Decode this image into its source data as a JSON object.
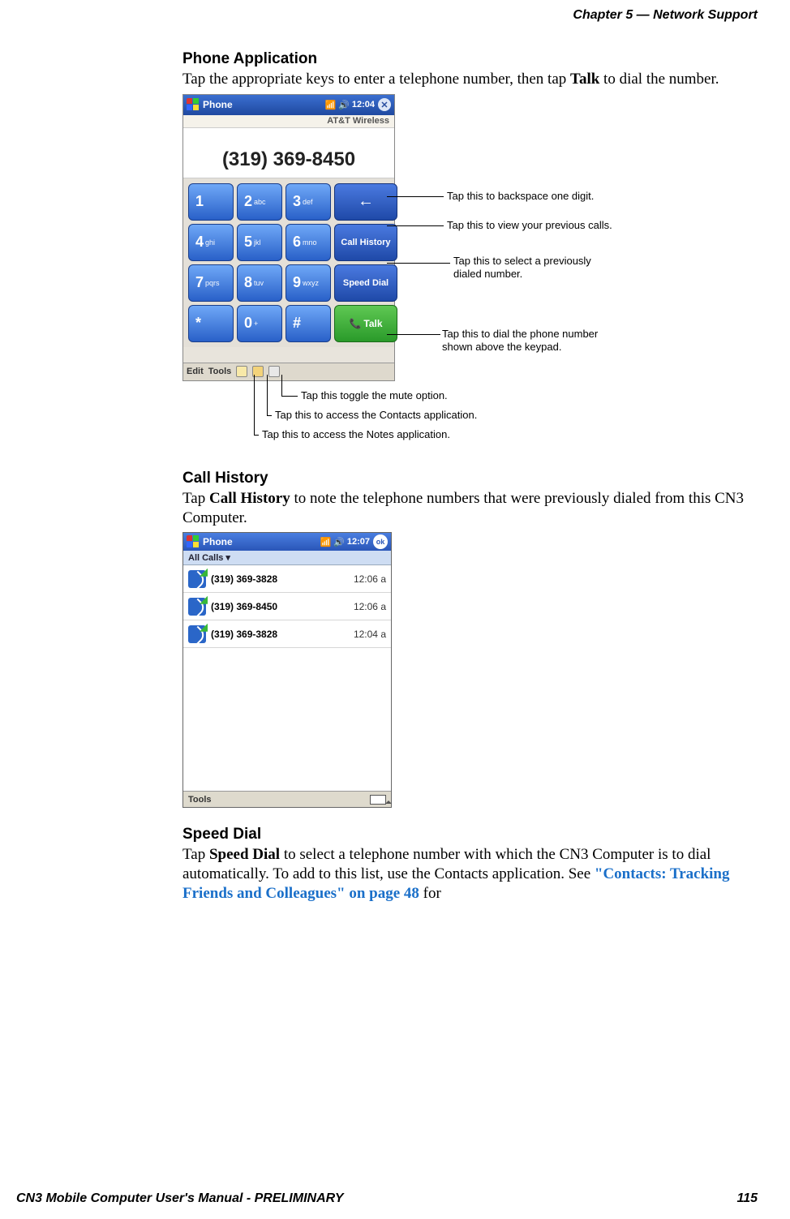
{
  "running_head": "Chapter 5 —  Network Support",
  "footer_left": "CN3 Mobile Computer User's Manual - PRELIMINARY",
  "footer_right": "115",
  "sec1": {
    "title": "Phone Application",
    "body_a": "Tap the appropriate keys to enter a telephone number, then tap ",
    "body_bold": "Talk",
    "body_b": " to dial the number."
  },
  "phone1": {
    "titlebar": "Phone",
    "time": "12:04",
    "close_glyph": "✕",
    "signal_glyph": "📶",
    "speaker_glyph": "🔊",
    "carrier": "AT&T Wireless",
    "number": "(319) 369-8450",
    "keys": [
      {
        "n": "1",
        "s": ""
      },
      {
        "n": "2",
        "s": "abc"
      },
      {
        "n": "3",
        "s": "def"
      },
      {
        "n": "4",
        "s": "ghi"
      },
      {
        "n": "5",
        "s": "jkl"
      },
      {
        "n": "6",
        "s": "mno"
      },
      {
        "n": "7",
        "s": "pqrs"
      },
      {
        "n": "8",
        "s": "tuv"
      },
      {
        "n": "9",
        "s": "wxyz"
      },
      {
        "n": "*",
        "s": ""
      },
      {
        "n": "0",
        "s": "+"
      },
      {
        "n": "#",
        "s": ""
      }
    ],
    "side": {
      "backspace": "←",
      "call_history": "Call History",
      "speed_dial": "Speed Dial",
      "talk": "Talk",
      "talk_icon": "📞"
    },
    "menu_edit": "Edit",
    "menu_tools": "Tools"
  },
  "callouts1": {
    "backspace": "Tap this to backspace one digit.",
    "history": "Tap this to view your previous calls.",
    "speeddial": "Tap this to select a previously dialed number.",
    "talk": "Tap this to dial the phone number shown above the keypad.",
    "mute": "Tap this toggle the mute option.",
    "contacts": "Tap this to access the Contacts application.",
    "notes": "Tap this to access the Notes application."
  },
  "sec2": {
    "title": "Call History",
    "body_a": "Tap ",
    "body_bold": "Call History",
    "body_b": " to note the telephone numbers that were previously dialed from this CN3 Computer."
  },
  "phone2": {
    "titlebar": "Phone",
    "time": "12:07",
    "ok": "ok",
    "signal_glyph": "📶",
    "speaker_glyph": "🔊",
    "filter": "All Calls",
    "filter_arrow": "▾",
    "rows": [
      {
        "num": "(319) 369-3828",
        "time": "12:06 a"
      },
      {
        "num": "(319) 369-8450",
        "time": "12:06 a"
      },
      {
        "num": "(319) 369-3828",
        "time": "12:04 a"
      }
    ],
    "tools": "Tools"
  },
  "sec3": {
    "title": "Speed Dial",
    "body_a": "Tap ",
    "body_bold": "Speed Dial",
    "body_b": " to select a telephone number with which the CN3 Computer is to dial automatically. To add to this list, use the Contacts application. See ",
    "link": "\"Contacts: Tracking Friends and Colleagues\" on page 48",
    "body_c": " for"
  }
}
